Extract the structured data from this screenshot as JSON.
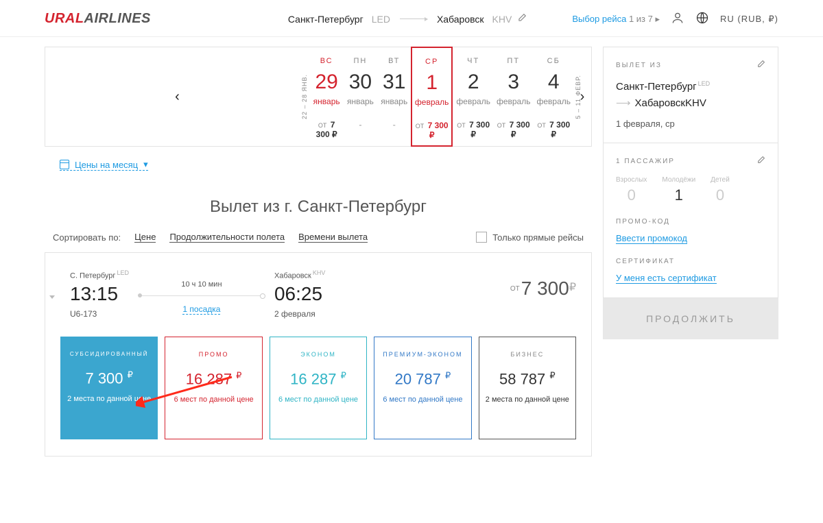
{
  "header": {
    "logo_a": "URAL",
    "logo_b": "AIRLINES",
    "from_city": "Санкт-Петербург",
    "from_code": "LED",
    "to_city": "Хабаровск",
    "to_code": "KHV",
    "step_label": "Выбор рейса",
    "step_n": "1 из 7",
    "locale": "RU (RUB, ₽)"
  },
  "date_strip": {
    "prev_label": "22 – 28 ЯНВ.",
    "next_label": "5 – 11 ФЕВР.",
    "days": [
      {
        "dow": "ВС",
        "num": "29",
        "mon": "январь",
        "ot": "ОТ",
        "price": "7 300 ₽",
        "cls": "past"
      },
      {
        "dow": "ПН",
        "num": "30",
        "mon": "январь",
        "ot": "",
        "price": "-",
        "cls": "nop"
      },
      {
        "dow": "ВТ",
        "num": "31",
        "mon": "январь",
        "ot": "",
        "price": "-",
        "cls": "nop"
      },
      {
        "dow": "СР",
        "num": "1",
        "mon": "февраль",
        "ot": "ОТ",
        "price": "7 300 ₽",
        "cls": "sel"
      },
      {
        "dow": "ЧТ",
        "num": "2",
        "mon": "февраль",
        "ot": "ОТ",
        "price": "7 300 ₽",
        "cls": ""
      },
      {
        "dow": "ПТ",
        "num": "3",
        "mon": "февраль",
        "ot": "ОТ",
        "price": "7 300 ₽",
        "cls": ""
      },
      {
        "dow": "СБ",
        "num": "4",
        "mon": "февраль",
        "ot": "ОТ",
        "price": "7 300 ₽",
        "cls": ""
      }
    ]
  },
  "month_link": "Цены на месяц",
  "section_title": "Вылет из г. Санкт-Петербург",
  "sort": {
    "label": "Сортировать по:",
    "opts": [
      "Цене",
      "Продолжительности полета",
      "Времени вылета"
    ],
    "direct_only": "Только прямые рейсы"
  },
  "flight": {
    "from_city": "С. Петербург",
    "from_code": "LED",
    "from_time": "13:15",
    "flight_no": "U6-173",
    "duration": "10 ч 10 мин",
    "stops": "1 посадка",
    "to_city": "Хабаровск",
    "to_code": "KHV",
    "to_time": "06:25",
    "to_date": "2 февраля",
    "price_ot": "ОТ",
    "price_val": "7 300",
    "fares": [
      {
        "name": "СУБСИДИРОВАННЫЙ",
        "price": "7 300",
        "avail": "2 места по данной цене",
        "cls": "sub"
      },
      {
        "name": "ПРОМО",
        "price": "16 287",
        "avail": "6 мест по данной цене",
        "cls": "promo"
      },
      {
        "name": "ЭКОНОМ",
        "price": "16 287",
        "avail": "6 мест по данной цене",
        "cls": "econ"
      },
      {
        "name": "ПРЕМИУМ-ЭКОНОМ",
        "price": "20 787",
        "avail": "6 мест по данной цене",
        "cls": "prem"
      },
      {
        "name": "БИЗНЕС",
        "price": "58 787",
        "avail": "2 места по данной цене",
        "cls": "biz"
      }
    ]
  },
  "sidebar": {
    "h1": "ВЫЛЕТ ИЗ",
    "from": "Санкт-Петербург",
    "from_code": "LED",
    "to": "Хабаровск",
    "to_code": "KHV",
    "date": "1 февраля, ср",
    "pax_title": "1 ПАССАЖИР",
    "pax": [
      {
        "label": "Взрослых",
        "n": "0",
        "active": false
      },
      {
        "label": "Молодёжи",
        "n": "1",
        "active": true
      },
      {
        "label": "Детей",
        "n": "0",
        "active": false
      }
    ],
    "promo_h": "ПРОМО-КОД",
    "promo_link": "Ввести промокод",
    "cert_h": "СЕРТИФИКАТ",
    "cert_link": "У меня есть сертификат",
    "continue": "ПРОДОЛЖИТЬ"
  }
}
